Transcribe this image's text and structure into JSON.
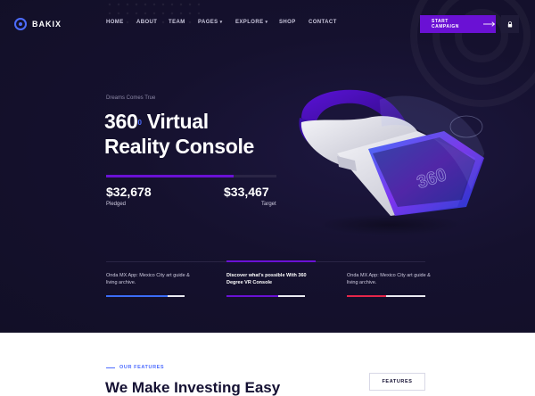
{
  "header": {
    "logo_text": "BAKIX",
    "nav": [
      {
        "label": "HOME"
      },
      {
        "label": "ABOUT"
      },
      {
        "label": "TEAM"
      },
      {
        "label": "PAGES",
        "dropdown": true
      },
      {
        "label": "EXPLORE",
        "dropdown": true
      },
      {
        "label": "SHOP"
      },
      {
        "label": "CONTACT"
      }
    ],
    "cta_label": "START CAMPAIGN",
    "icons": {
      "cta": "arrow-right-icon",
      "lock": "lock-icon",
      "logo": "bakix-logo-icon",
      "dropdown": "chevron-down-icon"
    }
  },
  "hero": {
    "tagline": "Dreams Comes True",
    "title_number": "360",
    "title_degree": "0",
    "title_rest": "Virtual",
    "title_line2": "Reality Console",
    "progress": 0.75,
    "pledged_value": "$32,678",
    "pledged_label": "Pledged",
    "target_value": "$33,467",
    "target_label": "Target",
    "image_text": "360"
  },
  "features_row": [
    {
      "text": "Onda MX App: Mexico City art guide & living archive.",
      "active": false,
      "bar_color": "#3b6cf6",
      "fill": 0.78
    },
    {
      "text": "Discover what's possible With 360 Degree VR Console",
      "active": true,
      "bar_color": "#6a11d4",
      "fill": 0.66
    },
    {
      "text": "Onda MX App: Mexico City art guide & living archive.",
      "active": false,
      "bar_color": "#e5264a",
      "fill": 0.5
    }
  ],
  "bottom": {
    "eyebrow": "OUR FEATURES",
    "title": "We Make Investing Easy",
    "features_button": "FEATURES"
  },
  "colors": {
    "hero_bg": "#15112e",
    "accent_purple": "#6a11d4",
    "accent_blue": "#4d6cff",
    "accent_red": "#e5264a"
  }
}
